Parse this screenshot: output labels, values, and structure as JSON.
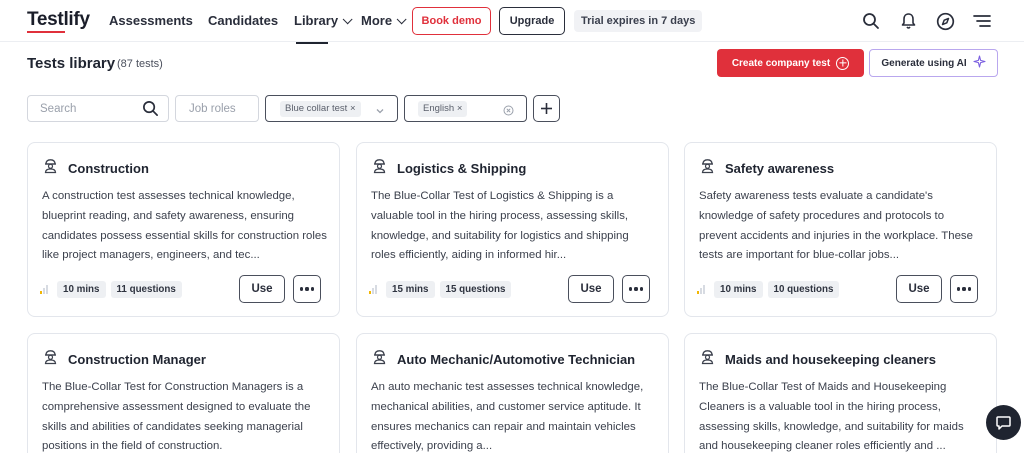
{
  "brand": {
    "logo": "Testlify",
    "accent": "#e0303b"
  },
  "nav": {
    "items": [
      {
        "label": "Assessments"
      },
      {
        "label": "Candidates"
      },
      {
        "label": "Library"
      },
      {
        "label": "More"
      }
    ],
    "book_demo": "Book demo",
    "upgrade": "Upgrade",
    "trial": "Trial expires in 7 days"
  },
  "header": {
    "title": "Tests library",
    "count": "(87 tests)",
    "create_button": "Create company test",
    "ai_button": "Generate using AI"
  },
  "filters": {
    "search_placeholder": "Search",
    "job_roles_placeholder": "Job roles",
    "selected_category": "Blue collar test",
    "selected_language": "English"
  },
  "cards": [
    {
      "title": "Construction",
      "description": "A construction test assesses technical knowledge, blueprint reading, and safety awareness, ensuring candidates possess essential skills for construction roles like project managers, engineers, and tec...",
      "duration": "10 mins",
      "questions": "11 questions",
      "difficulty": 1,
      "use": "Use"
    },
    {
      "title": "Logistics & Shipping",
      "description": "The Blue-Collar Test of Logistics & Shipping is a valuable tool in the hiring process, assessing skills, knowledge, and suitability for logistics and shipping roles efficiently, aiding in informed hir...",
      "duration": "15 mins",
      "questions": "15 questions",
      "difficulty": 1,
      "use": "Use"
    },
    {
      "title": "Safety awareness",
      "description": "Safety awareness tests evaluate a candidate's knowledge of safety procedures and protocols to prevent accidents and injuries in the workplace. These tests are important for blue-collar jobs...",
      "duration": "10 mins",
      "questions": "10 questions",
      "difficulty": 1,
      "use": "Use"
    },
    {
      "title": "Construction Manager",
      "description": "The Blue-Collar Test for Construction Managers is a comprehensive assessment designed to evaluate the skills and abilities of candidates seeking managerial positions in the field of construction.",
      "duration": "",
      "questions": "",
      "difficulty": 1,
      "use": "Use"
    },
    {
      "title": "Auto Mechanic/Automotive Technician",
      "description": "An auto mechanic test assesses technical knowledge, mechanical abilities, and customer service aptitude. It ensures mechanics can repair and maintain vehicles effectively, providing a...",
      "duration": "",
      "questions": "",
      "difficulty": 1,
      "use": "Use"
    },
    {
      "title": "Maids and housekeeping cleaners",
      "description": "The Blue-Collar Test of Maids and Housekeeping Cleaners is a valuable tool in the hiring process, assessing skills, knowledge, and suitability for maids and housekeeping cleaner roles efficiently and ...",
      "duration": "",
      "questions": "",
      "difficulty": 1,
      "use": "Use"
    }
  ]
}
